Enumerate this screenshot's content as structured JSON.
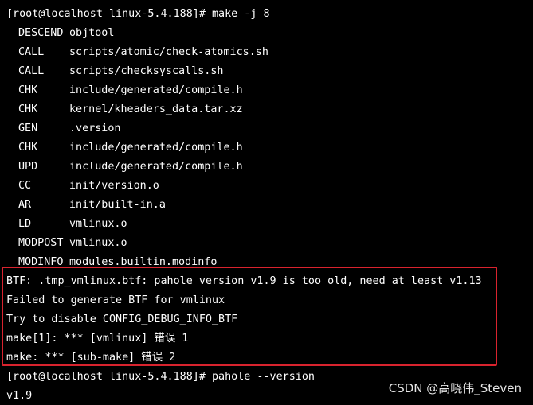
{
  "terminal": {
    "prompt_1": "[root@localhost linux-5.4.188]# make -j 8",
    "build_lines": [
      {
        "tag": "DESCEND",
        "arg": "objtool"
      },
      {
        "tag": "CALL",
        "arg": "scripts/atomic/check-atomics.sh"
      },
      {
        "tag": "CALL",
        "arg": "scripts/checksyscalls.sh"
      },
      {
        "tag": "CHK",
        "arg": "include/generated/compile.h"
      },
      {
        "tag": "CHK",
        "arg": "kernel/kheaders_data.tar.xz"
      },
      {
        "tag": "GEN",
        "arg": ".version"
      },
      {
        "tag": "CHK",
        "arg": "include/generated/compile.h"
      },
      {
        "tag": "UPD",
        "arg": "include/generated/compile.h"
      },
      {
        "tag": "CC",
        "arg": "init/version.o"
      },
      {
        "tag": "AR",
        "arg": "init/built-in.a"
      },
      {
        "tag": "LD",
        "arg": "vmlinux.o"
      },
      {
        "tag": "MODPOST",
        "arg": "vmlinux.o"
      },
      {
        "tag": "MODINFO",
        "arg": "modules.builtin.modinfo"
      }
    ],
    "error_lines": [
      "BTF: .tmp_vmlinux.btf: pahole version v1.9 is too old, need at least v1.13",
      "Failed to generate BTF for vmlinux",
      "Try to disable CONFIG_DEBUG_INFO_BTF",
      "make[1]: *** [vmlinux] 错误 1",
      "make: *** [sub-make] 错误 2"
    ],
    "prompt_2": "[root@localhost linux-5.4.188]# pahole --version",
    "output_version": "v1.9"
  },
  "watermark": "CSDN @高晓伟_Steven",
  "colors": {
    "background": "#000000",
    "text": "#ffffff",
    "highlight_border": "#d9232e"
  }
}
